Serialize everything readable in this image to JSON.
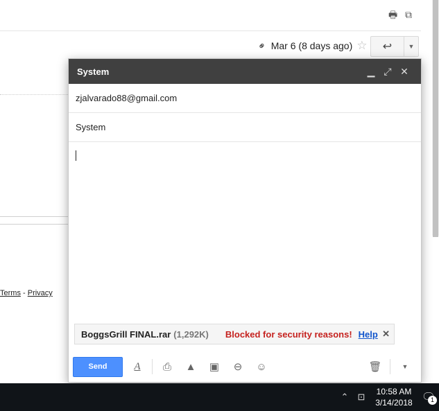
{
  "message": {
    "date_text": "Mar 6 (8 days ago)",
    "icons": [
      "print-icon",
      "popout-icon",
      "paperclip-icon",
      "star-icon",
      "reply-icon",
      "more-dropdown-icon"
    ]
  },
  "footer": {
    "terms": "Terms",
    "separator": " - ",
    "privacy": "Privacy"
  },
  "compose": {
    "title": "System",
    "to": "zjalvarado88@gmail.com",
    "subject": "System",
    "body": "",
    "attachment": {
      "name": "BoggsGrill FINAL.rar",
      "size": "(1,292K)",
      "warning": "Blocked for security reasons!",
      "help": "Help"
    },
    "send_label": "Send"
  },
  "taskbar": {
    "time": "10:58 AM",
    "date": "3/14/2018",
    "notification_count": "1"
  }
}
